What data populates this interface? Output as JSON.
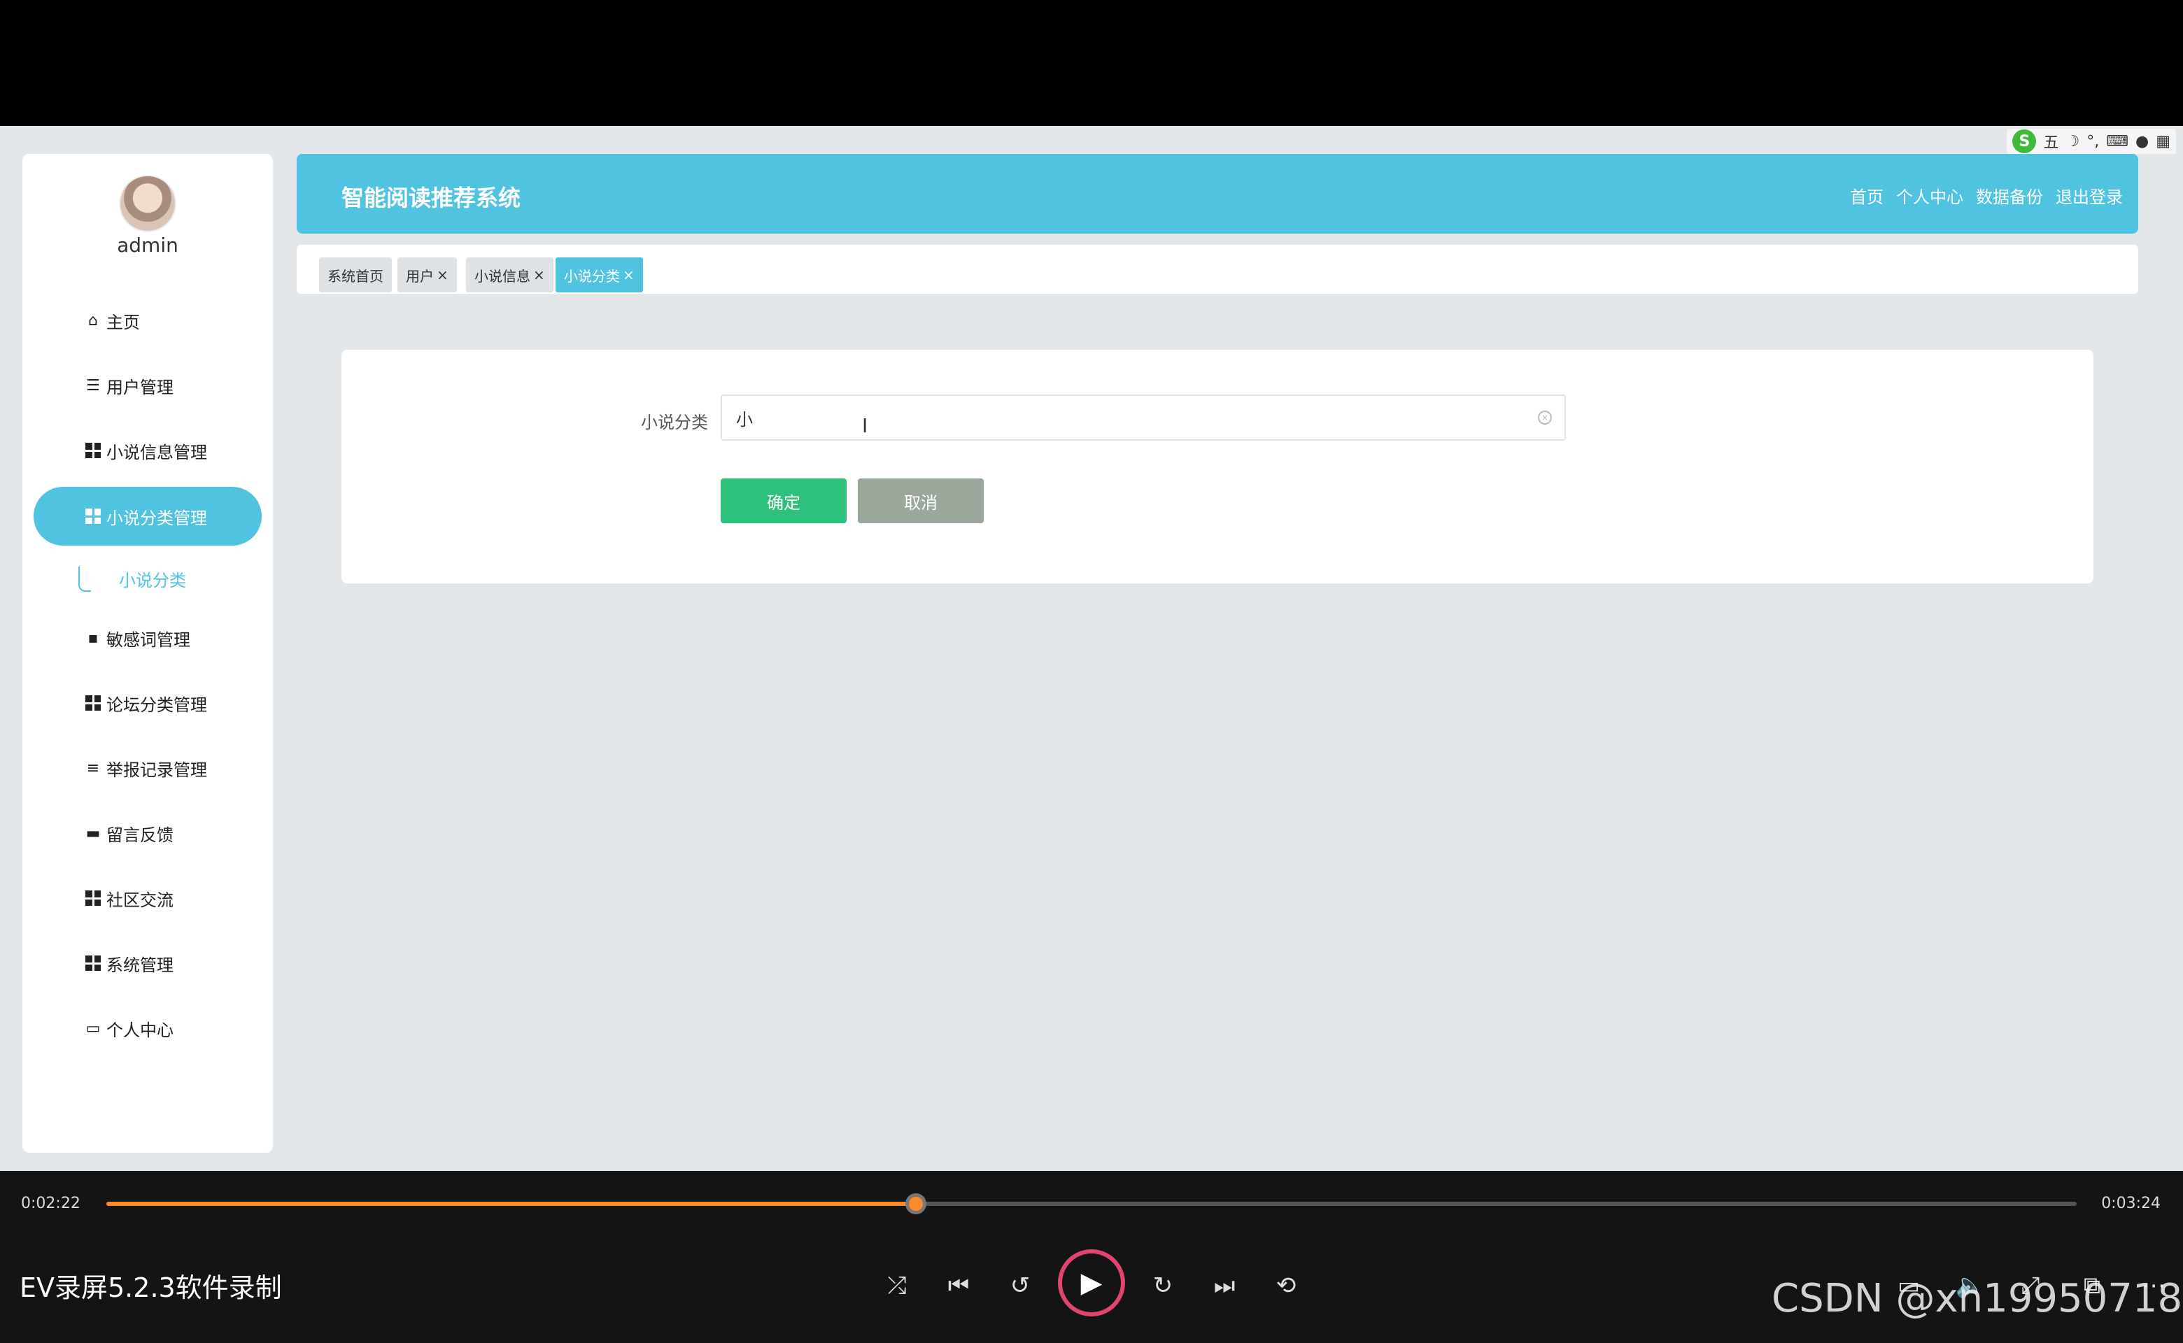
{
  "app": {
    "title": "智能阅读推荐系统",
    "header_nav": [
      "首页",
      "个人中心",
      "数据备份",
      "退出登录"
    ],
    "ime": {
      "mode": "五"
    }
  },
  "sidebar": {
    "username": "admin",
    "items": [
      {
        "label": "主页",
        "icon": "home-icon"
      },
      {
        "label": "用户管理",
        "icon": "list-icon"
      },
      {
        "label": "小说信息管理",
        "icon": "grid-icon"
      },
      {
        "label": "小说分类管理",
        "icon": "grid-icon",
        "active": true
      },
      {
        "label": "敏感词管理",
        "icon": "comment-icon"
      },
      {
        "label": "论坛分类管理",
        "icon": "grid-icon"
      },
      {
        "label": "举报记录管理",
        "icon": "sliders-icon"
      },
      {
        "label": "留言反馈",
        "icon": "monitor-icon"
      },
      {
        "label": "社区交流",
        "icon": "grid-icon"
      },
      {
        "label": "系统管理",
        "icon": "grid-icon"
      },
      {
        "label": "个人中心",
        "icon": "card-icon"
      }
    ],
    "sub_item": "小说分类"
  },
  "tabs": [
    {
      "label": "系统首页"
    },
    {
      "label": "用户",
      "close": "×"
    },
    {
      "label": "小说信息",
      "close": "×"
    },
    {
      "label": "小说分类",
      "close": "×",
      "active": true
    }
  ],
  "form": {
    "field_label": "小说分类",
    "field_value": "小",
    "ok_label": "确定",
    "cancel_label": "取消"
  },
  "player": {
    "current_time": "0:02:22",
    "total_time": "0:03:24",
    "progress": 0.411,
    "recorder_label": "EV录屏5.2.3软件录制",
    "watermark": "CSDN @xn19950718"
  },
  "colors": {
    "accent": "#4fc3e0",
    "ok": "#2ec17c",
    "cancel": "#9aa79a",
    "progress": "#ff8a2b"
  }
}
